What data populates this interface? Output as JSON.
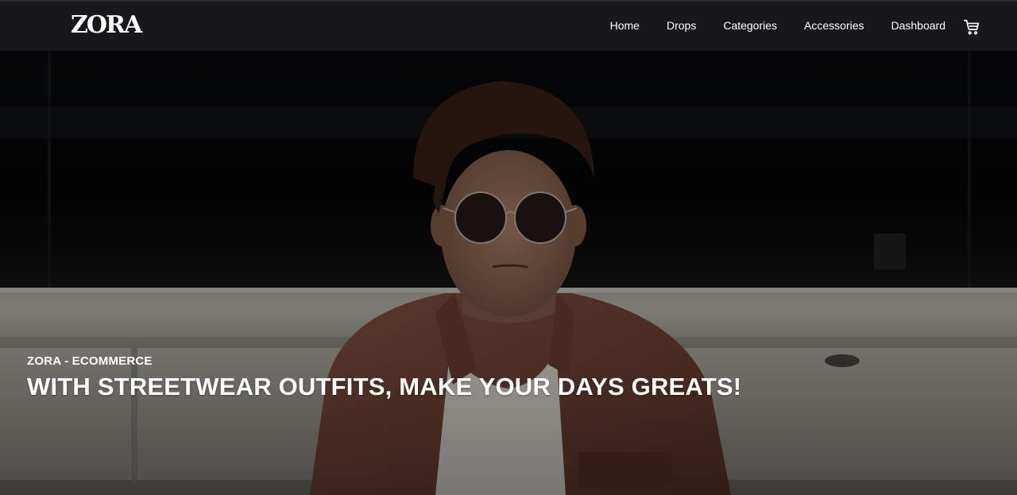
{
  "brand": {
    "logo": "ZORA"
  },
  "nav": {
    "items": [
      {
        "label": "Home"
      },
      {
        "label": "Drops"
      },
      {
        "label": "Categories"
      },
      {
        "label": "Accessories"
      },
      {
        "label": "Dashboard"
      }
    ],
    "cart_icon": "shopping-cart-icon"
  },
  "hero": {
    "eyebrow": "ZORA - ECOMMERCE",
    "headline": "WITH STREETWEAR OUTFITS, MAKE YOUR DAYS GREATS!",
    "image": "man-with-sunglasses-photo"
  },
  "colors": {
    "navbar_bg": "#17171c",
    "text": "#ffffff"
  }
}
